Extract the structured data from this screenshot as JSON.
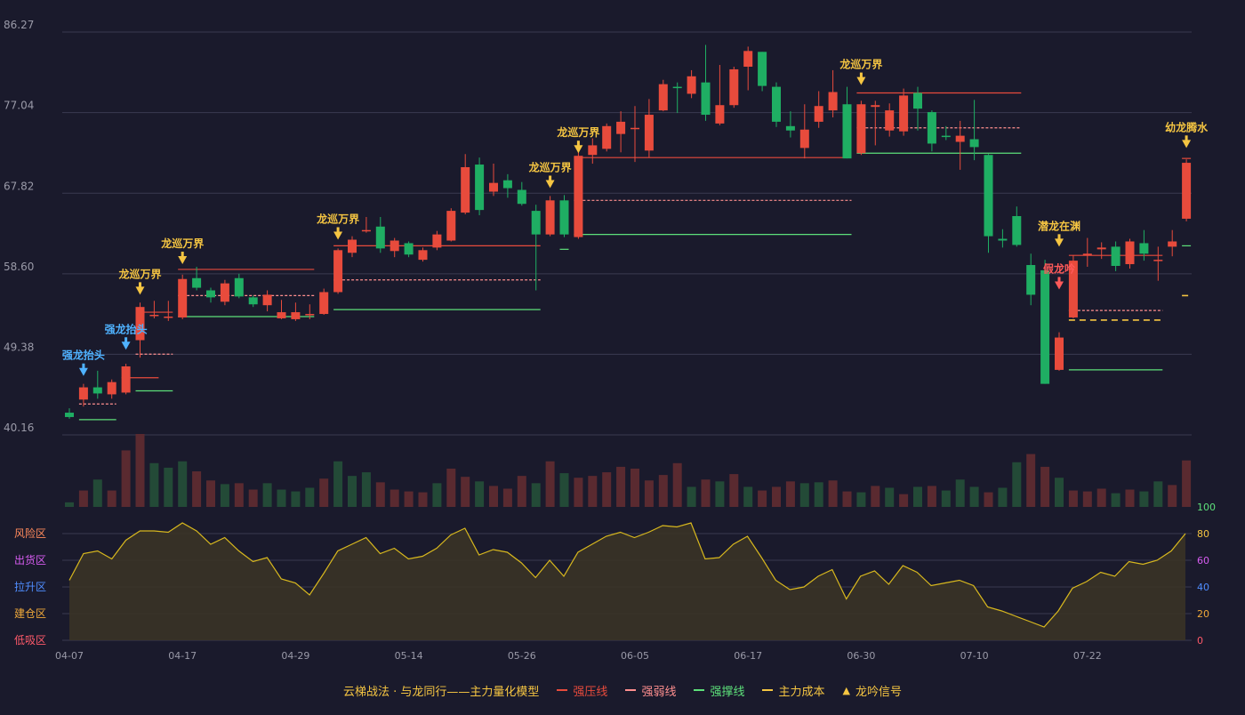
{
  "chart_data": {
    "type": "candlestick",
    "colors": {
      "background": "#1a1a2c",
      "up": "#e84b3c",
      "down": "#1fae63",
      "grid": "#3a3a50",
      "axis_text": "#9a9aa8",
      "strong_pressure": "#e84b3c",
      "weak_line": "#ff8f8f",
      "support": "#5de07a",
      "cost": "#f5c542",
      "signal_gold": "#f5c542",
      "signal_blue": "#4fb2ff",
      "signal_red": "#ff5a5a",
      "oscillator": "#d8b81e"
    },
    "y_axis": {
      "ticks": [
        "86.27",
        "77.04",
        "67.82",
        "58.60",
        "49.38",
        "40.16"
      ],
      "range": [
        40.16,
        86.27
      ]
    },
    "x_axis": {
      "labels": [
        {
          "i": 0,
          "text": "04-07"
        },
        {
          "i": 8,
          "text": "04-17"
        },
        {
          "i": 16,
          "text": "04-29"
        },
        {
          "i": 24,
          "text": "05-14"
        },
        {
          "i": 32,
          "text": "05-26"
        },
        {
          "i": 40,
          "text": "06-05"
        },
        {
          "i": 48,
          "text": "06-17"
        },
        {
          "i": 56,
          "text": "06-30"
        },
        {
          "i": 64,
          "text": "07-10"
        },
        {
          "i": 72,
          "text": "07-22"
        }
      ]
    },
    "candles": [
      [
        42.7,
        42.2,
        43.2,
        42.0
      ],
      [
        44.2,
        45.6,
        46.0,
        43.4
      ],
      [
        45.6,
        44.9,
        47.5,
        44.3
      ],
      [
        44.8,
        46.2,
        46.5,
        44.3
      ],
      [
        45.0,
        48.0,
        48.3,
        44.8
      ],
      [
        51.0,
        54.8,
        55.3,
        49.0
      ],
      [
        53.8,
        53.9,
        55.5,
        53.5
      ],
      [
        53.7,
        53.7,
        55.5,
        53.2
      ],
      [
        53.6,
        58.0,
        58.5,
        53.4
      ],
      [
        58.1,
        57.0,
        59.4,
        56.7
      ],
      [
        56.7,
        55.9,
        57.0,
        55.3
      ],
      [
        55.4,
        57.5,
        57.9,
        55.0
      ],
      [
        58.1,
        56.0,
        58.6,
        55.8
      ],
      [
        55.9,
        55.1,
        56.1,
        54.8
      ],
      [
        55.0,
        56.2,
        56.7,
        54.3
      ],
      [
        53.5,
        54.2,
        55.6,
        53.4
      ],
      [
        53.4,
        54.2,
        55.3,
        53.2
      ],
      [
        54.0,
        54.0,
        55.1,
        53.4
      ],
      [
        54.0,
        56.5,
        56.9,
        53.9
      ],
      [
        56.5,
        61.3,
        61.5,
        56.3
      ],
      [
        61.0,
        62.5,
        62.9,
        60.5
      ],
      [
        63.5,
        63.6,
        65.1,
        63.3
      ],
      [
        64.0,
        61.5,
        65.1,
        61.0
      ],
      [
        61.2,
        62.4,
        62.7,
        60.5
      ],
      [
        62.1,
        60.8,
        62.3,
        60.5
      ],
      [
        60.2,
        61.3,
        61.6,
        60.0
      ],
      [
        61.6,
        63.1,
        63.5,
        61.3
      ],
      [
        62.4,
        65.8,
        66.1,
        62.3
      ],
      [
        65.6,
        70.8,
        72.3,
        65.4
      ],
      [
        71.1,
        65.9,
        71.9,
        65.3
      ],
      [
        68.0,
        69.0,
        71.2,
        67.5
      ],
      [
        69.3,
        68.4,
        70.0,
        67.3
      ],
      [
        68.2,
        66.6,
        69.1,
        66.4
      ],
      [
        65.8,
        63.1,
        66.5,
        56.7
      ],
      [
        63.1,
        67.0,
        67.5,
        62.9
      ],
      [
        67.0,
        63.1,
        67.6,
        62.8
      ],
      [
        62.8,
        72.1,
        73.0,
        62.6
      ],
      [
        72.2,
        73.3,
        74.1,
        71.2
      ],
      [
        72.9,
        75.5,
        75.8,
        72.6
      ],
      [
        74.6,
        76.0,
        77.2,
        72.5
      ],
      [
        75.2,
        75.3,
        77.8,
        71.4
      ],
      [
        72.7,
        76.8,
        78.6,
        71.9
      ],
      [
        77.3,
        80.3,
        80.8,
        77.2
      ],
      [
        80.0,
        79.9,
        80.5,
        77.0
      ],
      [
        79.2,
        81.2,
        81.9,
        78.7
      ],
      [
        80.5,
        76.8,
        84.8,
        76.1
      ],
      [
        75.8,
        77.9,
        82.5,
        75.6
      ],
      [
        77.9,
        82.0,
        82.3,
        77.6
      ],
      [
        82.3,
        84.1,
        84.6,
        79.6
      ],
      [
        84.0,
        80.1,
        84.0,
        79.5
      ],
      [
        80.0,
        76.0,
        80.5,
        75.4
      ],
      [
        75.5,
        75.0,
        77.2,
        74.2
      ],
      [
        73.0,
        75.1,
        78.0,
        71.8
      ],
      [
        76.0,
        77.8,
        79.5,
        75.3
      ],
      [
        77.3,
        79.4,
        81.9,
        76.5
      ],
      [
        78.0,
        71.8,
        80.0,
        71.8
      ],
      [
        72.4,
        78.0,
        78.4,
        72.2
      ],
      [
        77.7,
        77.9,
        78.4,
        73.3
      ],
      [
        75.0,
        77.3,
        78.1,
        74.3
      ],
      [
        74.9,
        79.0,
        79.8,
        74.4
      ],
      [
        79.3,
        77.5,
        80.0,
        75.0
      ],
      [
        77.1,
        73.5,
        77.3,
        72.6
      ],
      [
        74.4,
        74.3,
        75.5,
        73.9
      ],
      [
        73.7,
        74.4,
        76.1,
        70.5
      ],
      [
        74.0,
        73.1,
        78.5,
        71.6
      ],
      [
        72.2,
        62.9,
        72.3,
        61.0
      ],
      [
        62.6,
        62.4,
        63.7,
        61.6
      ],
      [
        65.2,
        61.9,
        66.3,
        61.7
      ],
      [
        59.6,
        56.2,
        60.9,
        55.0
      ],
      [
        59.0,
        46.0,
        60.2,
        46.0
      ],
      [
        47.6,
        51.3,
        51.9,
        47.5
      ],
      [
        53.6,
        60.1,
        60.7,
        53.5
      ],
      [
        60.7,
        60.9,
        62.7,
        59.4
      ],
      [
        61.4,
        61.6,
        62.2,
        60.3
      ],
      [
        61.7,
        59.5,
        62.3,
        58.9
      ],
      [
        59.7,
        62.3,
        62.6,
        59.2
      ],
      [
        62.1,
        60.9,
        63.6,
        60.1
      ],
      [
        60.2,
        60.2,
        61.7,
        57.8
      ],
      [
        61.7,
        62.3,
        63.6,
        60.6
      ],
      [
        64.9,
        71.3,
        71.7,
        64.6
      ]
    ],
    "volume_up_flags": [
      1,
      0,
      1,
      0,
      0,
      0,
      1,
      1,
      1,
      0,
      0,
      1,
      0,
      0,
      1,
      1,
      1,
      1,
      0,
      1,
      1,
      1,
      0,
      0,
      0,
      0,
      1,
      0,
      0,
      1,
      0,
      0,
      0,
      1,
      0,
      1,
      0,
      0,
      0,
      0,
      0,
      0,
      0,
      0,
      1,
      0,
      1,
      0,
      1,
      0,
      0,
      0,
      1,
      1,
      0,
      0,
      1,
      0,
      1,
      0,
      1,
      0,
      1,
      1,
      1,
      0,
      1,
      1,
      0,
      0,
      1,
      0,
      0,
      0,
      1,
      0,
      1,
      1,
      0,
      0
    ],
    "volume": [
      5,
      18,
      30,
      18,
      62,
      80,
      48,
      43,
      50,
      39,
      29,
      25,
      26,
      19,
      26,
      19,
      17,
      21,
      31,
      50,
      34,
      38,
      27,
      19,
      17,
      16,
      26,
      42,
      33,
      28,
      23,
      20,
      34,
      26,
      50,
      37,
      32,
      34,
      38,
      44,
      42,
      29,
      35,
      48,
      22,
      30,
      28,
      36,
      22,
      18,
      22,
      28,
      26,
      27,
      29,
      17,
      16,
      23,
      21,
      14,
      22,
      23,
      18,
      30,
      22,
      16,
      21,
      49,
      58,
      44,
      32,
      18,
      17,
      20,
      15,
      19,
      17,
      28,
      24,
      51
    ],
    "oscillator": {
      "zones": [
        "风险区",
        "出货区",
        "拉升区",
        "建仓区",
        "低吸区"
      ],
      "zone_colors": [
        "#ff8a5c",
        "#d65cf0",
        "#4f8dff",
        "#f0a93a",
        "#ff5a6a"
      ],
      "ticks": [
        "100",
        "80",
        "60",
        "40",
        "20",
        "0"
      ],
      "tick_colors": [
        "#5de07a",
        "#f5c542",
        "#d65cf0",
        "#4f8dff",
        "#f0a93a",
        "#ff5a6a"
      ],
      "values": [
        45,
        65,
        67,
        61,
        75,
        82,
        82,
        81,
        88,
        82,
        72,
        77,
        67,
        59,
        62,
        46,
        43,
        34,
        50,
        67,
        72,
        77,
        65,
        69,
        61,
        63,
        69,
        79,
        84,
        64,
        68,
        66,
        58,
        47,
        60,
        48,
        66,
        72,
        78,
        81,
        77,
        81,
        86,
        85,
        88,
        61,
        62,
        72,
        78,
        62,
        45,
        38,
        40,
        48,
        53,
        31,
        48,
        52,
        42,
        56,
        51,
        41,
        43,
        45,
        41,
        25,
        22,
        18,
        14,
        10,
        22,
        39,
        44,
        51,
        48,
        59,
        57,
        60,
        67,
        80
      ]
    },
    "lines": {
      "strong_pressure": [
        [
          4,
          6,
          46.7
        ],
        [
          5,
          7,
          54.2
        ],
        [
          8,
          17,
          59.1
        ],
        [
          19,
          33,
          61.8
        ],
        [
          36,
          55,
          71.9
        ],
        [
          56,
          67,
          79.3
        ],
        [
          71,
          77,
          60.7
        ],
        [
          79,
          79,
          71.8
        ]
      ],
      "weak_line": [
        [
          1,
          3,
          43.7
        ],
        [
          5,
          7,
          49.4
        ],
        [
          8,
          17,
          56.1
        ],
        [
          19,
          33,
          57.9
        ],
        [
          36,
          55,
          67.0
        ],
        [
          56,
          67,
          75.3
        ],
        [
          71,
          77,
          54.4
        ]
      ],
      "support": [
        [
          1,
          3,
          41.9
        ],
        [
          5,
          7,
          45.2
        ],
        [
          8,
          17,
          53.7
        ],
        [
          19,
          33,
          54.5
        ],
        [
          35,
          35,
          61.4
        ],
        [
          36,
          55,
          63.1
        ],
        [
          56,
          67,
          72.4
        ],
        [
          71,
          77,
          47.6
        ],
        [
          79,
          79,
          61.8
        ]
      ],
      "cost": [
        [
          71,
          77,
          53.3
        ],
        [
          79,
          79,
          56.1
        ]
      ]
    },
    "signals": [
      {
        "i": 1,
        "text": "强龙抬头",
        "color": "blue",
        "y": 46.6
      },
      {
        "i": 4,
        "text": "强龙抬头",
        "color": "blue",
        "y": 49.6
      },
      {
        "i": 5,
        "text": "龙巡万界",
        "color": "gold",
        "y": 55.9
      },
      {
        "i": 8,
        "text": "龙巡万界",
        "color": "gold",
        "y": 59.4
      },
      {
        "i": 19,
        "text": "龙巡万界",
        "color": "gold",
        "y": 62.2
      },
      {
        "i": 34,
        "text": "龙巡万界",
        "color": "gold",
        "y": 68.1
      },
      {
        "i": 36,
        "text": "龙巡万界",
        "color": "gold",
        "y": 72.1
      },
      {
        "i": 56,
        "text": "龙巡万界",
        "color": "gold",
        "y": 79.9
      },
      {
        "i": 70,
        "text": "潜龙在渊",
        "color": "gold",
        "y": 61.4
      },
      {
        "i": 70,
        "text": "假龙吟",
        "color": "red",
        "y": 56.5
      },
      {
        "i": 79,
        "text": "幼龙腾水",
        "color": "gold",
        "y": 72.7
      }
    ]
  },
  "legend": {
    "title": "云梯战法 · 与龙同行——主力量化模型",
    "strong_pressure": "强压线",
    "weak_line": "强弱线",
    "support": "强撑线",
    "cost": "主力成本",
    "signal": "龙吟信号"
  }
}
